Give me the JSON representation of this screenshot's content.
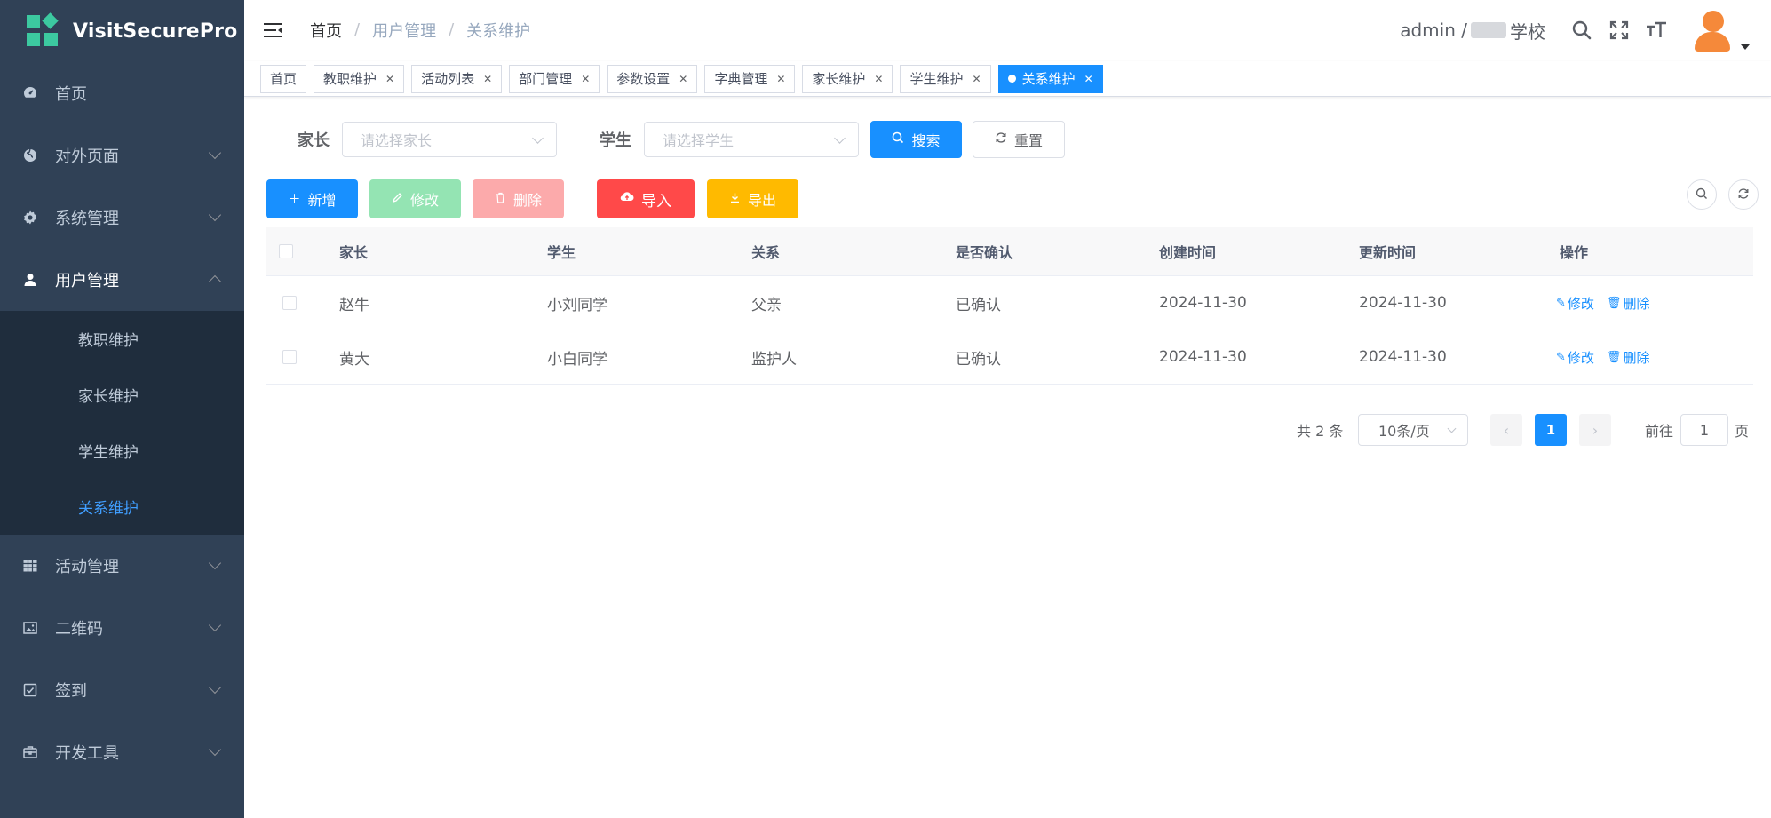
{
  "app": {
    "title": "VisitSecurePro"
  },
  "sidebar": {
    "items": [
      {
        "label": "首页",
        "icon": "dashboard-icon"
      },
      {
        "label": "对外页面",
        "icon": "globe-icon"
      },
      {
        "label": "系统管理",
        "icon": "gear-icon"
      },
      {
        "label": "用户管理",
        "icon": "user-icon"
      },
      {
        "label": "活动管理",
        "icon": "table-icon"
      },
      {
        "label": "二维码",
        "icon": "image-icon"
      },
      {
        "label": "签到",
        "icon": "checkbox-icon"
      },
      {
        "label": "开发工具",
        "icon": "toolbox-icon"
      }
    ],
    "submenu": [
      "教职维护",
      "家长维护",
      "学生维护",
      "关系维护"
    ],
    "active_color": "#409eff"
  },
  "header": {
    "breadcrumb": [
      "首页",
      "用户管理",
      "关系维护"
    ],
    "user_prefix": "admin / ",
    "user_suffix": "学校"
  },
  "tags": [
    "首页",
    "教职维护",
    "活动列表",
    "部门管理",
    "参数设置",
    "字典管理",
    "家长维护",
    "学生维护",
    "关系维护"
  ],
  "search": {
    "parent_label": "家长",
    "parent_placeholder": "请选择家长",
    "student_label": "学生",
    "student_placeholder": "请选择学生",
    "search_label": "搜索",
    "reset_label": "重置"
  },
  "toolbar": {
    "add_label": "新增",
    "edit_label": "修改",
    "delete_label": "删除",
    "import_label": "导入",
    "export_label": "导出"
  },
  "table": {
    "columns": [
      "家长",
      "学生",
      "关系",
      "是否确认",
      "创建时间",
      "更新时间",
      "操作"
    ],
    "rows": [
      {
        "parent": "赵牛",
        "student": "小刘同学",
        "relation": "父亲",
        "confirmed": "已确认",
        "created": "2024-11-30",
        "updated": "2024-11-30"
      },
      {
        "parent": "黄大",
        "student": "小白同学",
        "relation": "监护人",
        "confirmed": "已确认",
        "created": "2024-11-30",
        "updated": "2024-11-30"
      }
    ],
    "edit_action": "修改",
    "delete_action": "删除"
  },
  "pagination": {
    "total_text": "共 2 条",
    "page_size": "10条/页",
    "current_page": "1",
    "goto_label": "前往",
    "goto_value": "1",
    "page_suffix": "页"
  },
  "colors": {
    "primary": "#1890ff",
    "sidebar_bg": "#304156",
    "submenu_bg": "#1f2d3d",
    "danger": "#ff4949",
    "warning": "#ffba00"
  }
}
